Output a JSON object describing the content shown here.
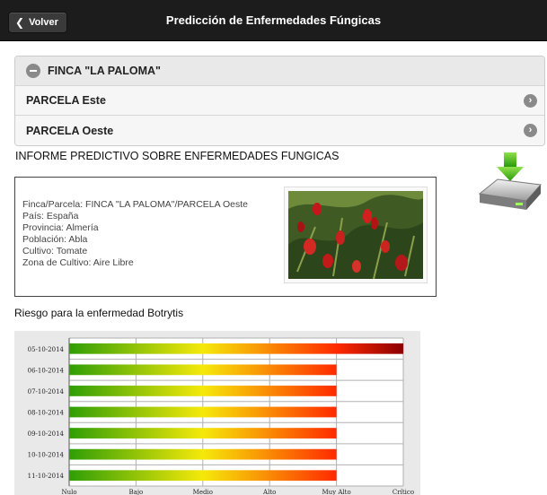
{
  "header": {
    "back_label": "Volver",
    "title": "Predicción de Enfermedades Fúngicas"
  },
  "finca": {
    "title": "FINCA \"LA PALOMA\"",
    "parcelas": [
      {
        "label": "PARCELA Este"
      },
      {
        "label": "PARCELA Oeste"
      }
    ]
  },
  "report": {
    "title": "INFORME PREDICTIVO SOBRE ENFERMEDADES FUNGICAS",
    "lines": [
      "Finca/Parcela: FINCA \"LA PALOMA\"/PARCELA Oeste",
      "País: España",
      "Provincia: Almería",
      "Población: Abla",
      "Cultivo: Tomate",
      "Zona de Cultivo: Aire Libre"
    ]
  },
  "risk": {
    "title": "Riesgo para la enfermedad Botrytis"
  },
  "chart_data": {
    "type": "bar",
    "orientation": "horizontal",
    "categories": [
      "05-10-2014",
      "06-10-2014",
      "07-10-2014",
      "08-10-2014",
      "09-10-2014",
      "10-10-2014",
      "11-10-2014"
    ],
    "values": [
      5,
      4,
      4,
      4,
      4,
      4,
      4
    ],
    "x_tick_labels": [
      "Nulo",
      "Bajo",
      "Medio",
      "Alto",
      "Muy Alto",
      "Crítico"
    ],
    "xlim": [
      0,
      5
    ],
    "gradient_colors": [
      "#2f9e06",
      "#f5e90a",
      "#ff2a00",
      "#8b0000"
    ],
    "grid": true
  }
}
